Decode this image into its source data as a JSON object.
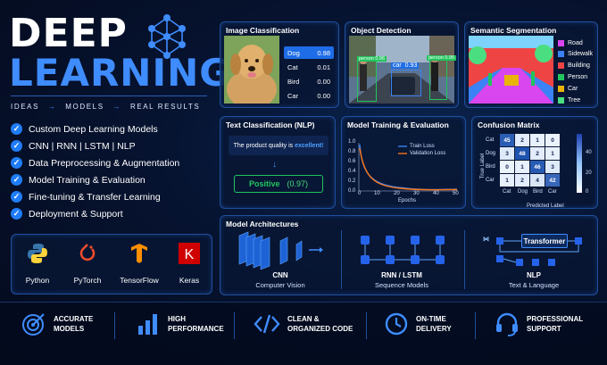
{
  "brand": {
    "line1": "DEEP",
    "line2": "LEARNING",
    "tagline": [
      "IDEAS",
      "→",
      "MODELS",
      "→",
      "REAL RESULTS"
    ]
  },
  "features": [
    "Custom Deep Learning Models",
    "CNN | RNN | LSTM | NLP",
    "Data Preprocessing & Augmentation",
    "Model Training & Evaluation",
    "Fine-tuning & Transfer Learning",
    "Deployment & Support"
  ],
  "tools": [
    "Python",
    "PyTorch",
    "TensorFlow",
    "Keras"
  ],
  "image_classification": {
    "title": "Image Classification",
    "rows": [
      {
        "label": "Dog",
        "score": "0.98"
      },
      {
        "label": "Cat",
        "score": "0.01"
      },
      {
        "label": "Bird",
        "score": "0.00"
      },
      {
        "label": "Car",
        "score": "0.00"
      }
    ]
  },
  "object_detection": {
    "title": "Object Detection",
    "boxes": [
      {
        "label": "person 0.96"
      },
      {
        "label": "car  0.93"
      },
      {
        "label": "person 0.95"
      }
    ]
  },
  "semantic_segmentation": {
    "title": "Semantic Segmentation",
    "legend": [
      {
        "label": "Road",
        "color": "#d946ef"
      },
      {
        "label": "Sidewalk",
        "color": "#3b82f6"
      },
      {
        "label": "Building",
        "color": "#ef4444"
      },
      {
        "label": "Person",
        "color": "#22c55e"
      },
      {
        "label": "Car",
        "color": "#eab308"
      },
      {
        "label": "Tree",
        "color": "#4ade80"
      }
    ]
  },
  "text_classification": {
    "title": "Text Classification (NLP)",
    "text_prefix": "The product quality is ",
    "text_highlight": "excellent!",
    "arrow": "↓",
    "result": "Positive",
    "score": "(0.97)"
  },
  "training": {
    "title": "Model Training & Evaluation",
    "legend_train": "Train Loss",
    "legend_val": "Validation Loss",
    "xlabel": "Epochs",
    "yticks": [
      "1.0",
      "0.8",
      "0.6",
      "0.4",
      "0.2",
      "0.0"
    ],
    "xticks": [
      "0",
      "10",
      "20",
      "30",
      "40",
      "50"
    ]
  },
  "confusion": {
    "title": "Confusion Matrix",
    "ylabel": "True Label",
    "xlabel": "Predicted Label",
    "labels": [
      "Cat",
      "Dog",
      "Bird",
      "Car"
    ],
    "matrix": [
      [
        45,
        2,
        1,
        0
      ],
      [
        3,
        48,
        2,
        1
      ],
      [
        0,
        1,
        46,
        3
      ],
      [
        1,
        2,
        4,
        42
      ]
    ],
    "scale": [
      "40",
      "20",
      "0"
    ]
  },
  "architectures": {
    "title": "Model Architectures",
    "items": [
      {
        "name": "CNN",
        "sub": "Computer Vision"
      },
      {
        "name": "RNN / LSTM",
        "sub": "Sequence Models"
      },
      {
        "name": "NLP",
        "sub": "Text & Language"
      }
    ],
    "transformer_label": "Transformer"
  },
  "bottom": [
    {
      "icon": "target-icon",
      "text": "ACCURATE\nMODELS"
    },
    {
      "icon": "bar-chart-icon",
      "text": "HIGH\nPERFORMANCE"
    },
    {
      "icon": "code-icon",
      "text": "CLEAN &\nORGANIZED CODE"
    },
    {
      "icon": "clock-icon",
      "text": "ON-TIME\nDELIVERY"
    },
    {
      "icon": "headset-icon",
      "text": "PROFESSIONAL\nSUPPORT"
    }
  ],
  "colors": {
    "accent": "#3f8cff",
    "positive": "#22c55e",
    "panel_border": "#1f4f9c"
  }
}
